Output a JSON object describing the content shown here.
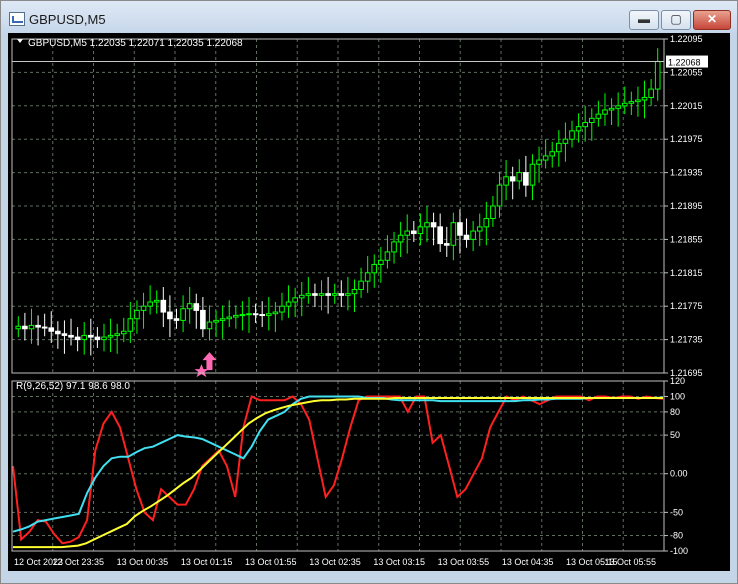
{
  "window": {
    "title": "GBPUSD,M5",
    "controls": {
      "minimize": "▬",
      "maximize": "▢",
      "close": "✕"
    }
  },
  "price_chart": {
    "symbol_header": "GBPUSD,M5  1.22035 1.22071 1.22035 1.22068",
    "current_price_label": "1.22068",
    "y_ticks": [
      "1.22095",
      "1.22055",
      "1.22015",
      "1.21975",
      "1.21935",
      "1.21895",
      "1.21855",
      "1.21815",
      "1.21775",
      "1.21735",
      "1.21695"
    ],
    "colors": {
      "background": "#000000",
      "bull": "#00ff00",
      "bear": "#ffffff",
      "grid": "#5f6e5f",
      "arrow": "#ff69b4",
      "axis_text": "#ffffff"
    }
  },
  "indicator_panel": {
    "header": "R(9,26,52) 97.1 98.6 98.0",
    "y_ticks": [
      "120",
      "100",
      "80",
      "50",
      "0.00",
      "-50",
      "-80",
      "-100"
    ],
    "colors": {
      "fast": "#ff2020",
      "medium": "#40e0f0",
      "slow": "#ffff30"
    }
  },
  "time_axis": [
    "12 Oct 2023",
    "12 Oct 23:35",
    "13 Oct 00:35",
    "13 Oct 01:15",
    "13 Oct 01:55",
    "13 Oct 02:35",
    "13 Oct 03:15",
    "13 Oct 03:55",
    "13 Oct 04:35",
    "13 Oct 05:15",
    "13 Oct 05:55"
  ],
  "chart_data": [
    {
      "type": "candlestick",
      "title": "GBPUSD,M5",
      "ylim": [
        1.21695,
        1.22095
      ],
      "close": [
        1.21751,
        1.21748,
        1.21752,
        1.2175,
        1.21749,
        1.21745,
        1.21742,
        1.2174,
        1.21738,
        1.21735,
        1.2174,
        1.21738,
        1.21735,
        1.21738,
        1.2174,
        1.21742,
        1.21745,
        1.2176,
        1.2177,
        1.21775,
        1.2178,
        1.21782,
        1.21768,
        1.2176,
        1.21758,
        1.21772,
        1.21778,
        1.2177,
        1.21748,
        1.21756,
        1.21758,
        1.2176,
        1.21762,
        1.21764,
        1.21765,
        1.21766,
        1.21765,
        1.21764,
        1.21766,
        1.21768,
        1.21775,
        1.2178,
        1.21785,
        1.21788,
        1.2179,
        1.21788,
        1.2179,
        1.21788,
        1.2179,
        1.21788,
        1.2179,
        1.21795,
        1.21805,
        1.21815,
        1.21825,
        1.2183,
        1.2184,
        1.21852,
        1.2186,
        1.21865,
        1.21862,
        1.2187,
        1.21875,
        1.2187,
        1.2185,
        1.21848,
        1.21875,
        1.2186,
        1.21855,
        1.21865,
        1.2187,
        1.2188,
        1.21895,
        1.2192,
        1.2193,
        1.21925,
        1.21935,
        1.2192,
        1.21945,
        1.2195,
        1.21955,
        1.2196,
        1.2197,
        1.21975,
        1.21985,
        1.2199,
        1.21995,
        1.22,
        1.22005,
        1.2201,
        1.22012,
        1.22015,
        1.22018,
        1.2202,
        1.22022,
        1.22025,
        1.22035,
        1.22068
      ],
      "current_price": 1.22068,
      "signal": {
        "type": "buy-arrow",
        "index": 29
      }
    },
    {
      "type": "line",
      "title": "R(9,26,52)",
      "ylim": [
        -100,
        120
      ],
      "series": [
        {
          "name": "",
          "values": [
            10,
            -85,
            -75,
            -60,
            -62,
            -78,
            -90,
            -88,
            -82,
            -60,
            30,
            65,
            80,
            60,
            20,
            -20,
            -50,
            -60,
            -20,
            -30,
            -40,
            -40,
            -20,
            10,
            20,
            30,
            10,
            -30,
            60,
            100,
            95,
            95,
            95,
            95,
            100,
            90,
            70,
            20,
            -30,
            -15,
            20,
            60,
            95,
            100,
            100,
            100,
            100,
            100,
            80,
            100,
            100,
            40,
            50,
            10,
            -30,
            -20,
            0,
            20,
            60,
            80,
            100,
            95,
            100,
            95,
            90,
            95,
            100,
            100,
            100,
            100,
            95,
            100,
            100,
            98,
            100,
            100,
            97,
            100,
            98,
            97.1
          ]
        },
        {
          "name": "",
          "values": [
            -75,
            -72,
            -68,
            -62,
            -60,
            -58,
            -56,
            -54,
            -52,
            -25,
            -5,
            10,
            20,
            22,
            22,
            28,
            33,
            35,
            40,
            45,
            50,
            48,
            47,
            45,
            40,
            35,
            30,
            25,
            20,
            35,
            55,
            70,
            75,
            80,
            90,
            97,
            100,
            100,
            100,
            100,
            100,
            100,
            100,
            98,
            98,
            98,
            96,
            95,
            95,
            95,
            95,
            95,
            94,
            94,
            94,
            94,
            94,
            94,
            94,
            94,
            94,
            94,
            95,
            95,
            96,
            96,
            97,
            97,
            97,
            97,
            98,
            98,
            98,
            98,
            98,
            98,
            98,
            98,
            98,
            98.6
          ]
        },
        {
          "name": "",
          "values": [
            -95,
            -95,
            -95,
            -95,
            -95,
            -95,
            -95,
            -94,
            -93,
            -90,
            -85,
            -80,
            -75,
            -70,
            -65,
            -55,
            -48,
            -42,
            -35,
            -28,
            -20,
            -12,
            -5,
            5,
            15,
            25,
            35,
            45,
            55,
            65,
            72,
            78,
            82,
            85,
            88,
            90,
            92,
            94,
            95,
            95,
            96,
            96,
            97,
            97,
            97,
            97,
            97,
            98,
            98,
            98,
            98,
            98,
            98,
            98,
            98,
            98,
            98,
            98,
            98,
            98,
            98,
            98,
            98,
            98,
            98,
            98,
            98,
            98,
            98,
            98,
            98,
            98,
            98,
            98,
            98,
            98,
            98,
            98,
            98,
            98,
            98.0
          ]
        }
      ]
    }
  ]
}
